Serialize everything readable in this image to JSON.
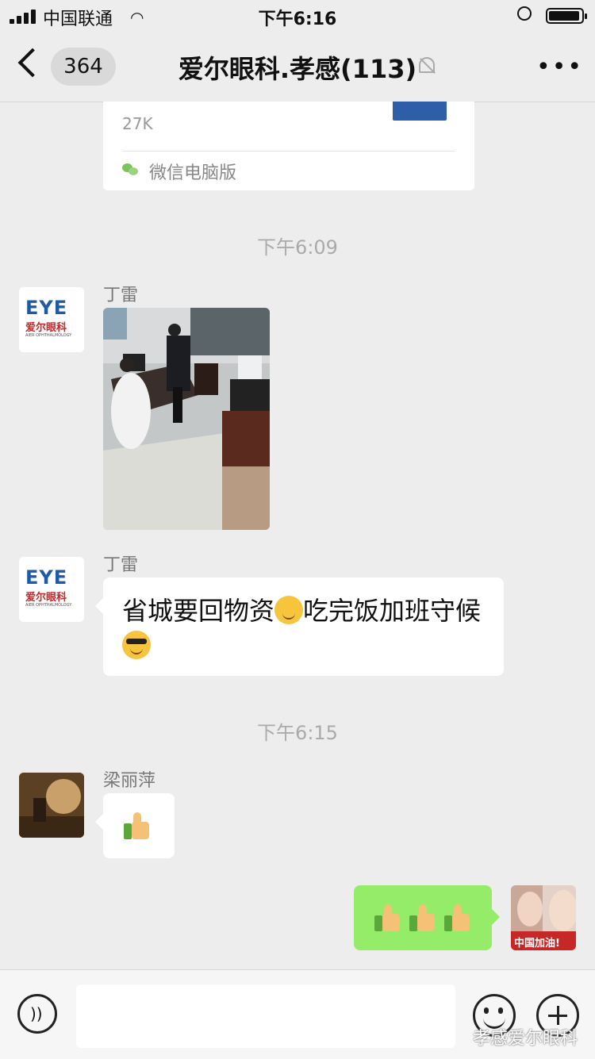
{
  "status_bar": {
    "carrier": "中国联通",
    "time": "下午6:16"
  },
  "nav": {
    "unread_count": "364",
    "title": "爱尔眼科.孝感(113)",
    "icons": [
      "back-chevron-icon",
      "mute-bell-icon",
      "more-icon"
    ]
  },
  "file_card": {
    "size": "27K",
    "source": "微信电脑版"
  },
  "messages": {
    "time1": "下午6:09",
    "sender1": "丁雷",
    "sender2": "丁雷",
    "text2_part1": "省城要回物资",
    "text2_part2": "吃完饭加班守候",
    "time2": "下午6:15",
    "sender3": "梁丽萍"
  },
  "avatars": {
    "eye_logo_text": "EYE",
    "eye_logo_cn": "爱尔眼科",
    "eye_logo_en": "AIER OPHTHALMOLOGY",
    "self_avatar_text": "中国加油!"
  },
  "bottom_bar": {
    "watermark": "孝感爱尔眼科"
  },
  "colors": {
    "background": "#ededed",
    "sent_bubble": "#95ec69",
    "logo_blue": "#1e5aa8",
    "logo_red": "#c62828"
  }
}
